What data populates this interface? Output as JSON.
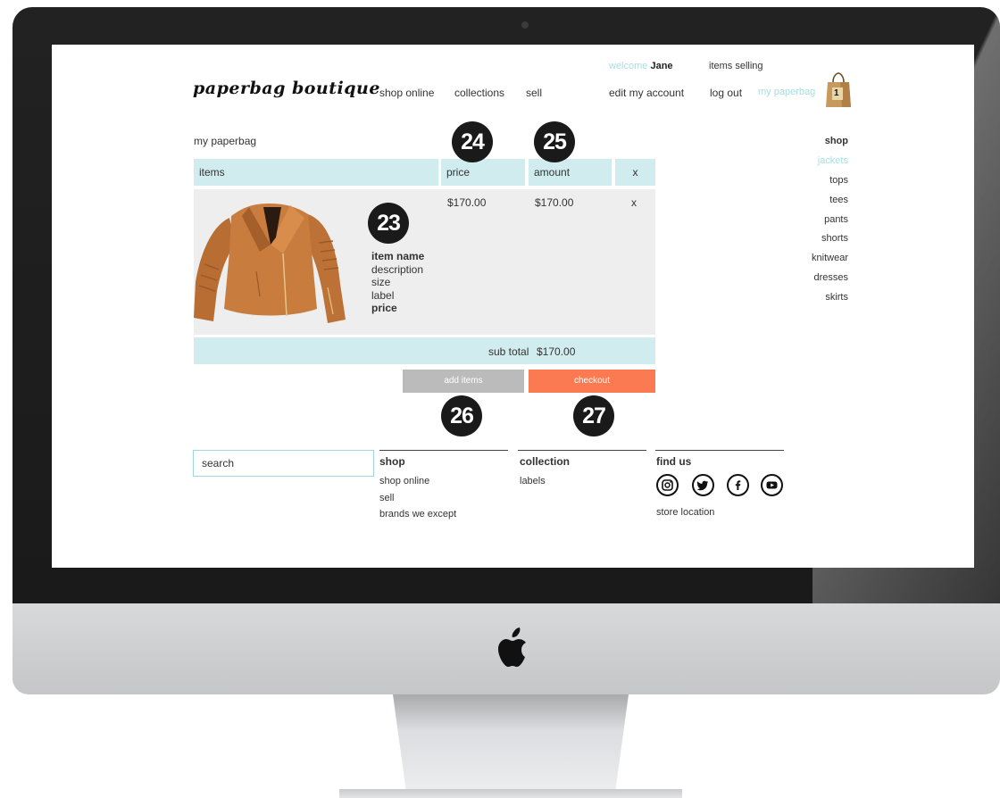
{
  "brand": {
    "logo_text": "paperbag boutique"
  },
  "nav": {
    "shop_online": "shop online",
    "collections": "collections",
    "sell": "sell"
  },
  "account": {
    "welcome_label": "welcome",
    "user_name": "Jane",
    "items_selling": "items selling",
    "edit_account": "edit my account",
    "log_out": "log out",
    "my_paperbag": "my paperbag",
    "bag_count": "1"
  },
  "cart": {
    "title": "my paperbag",
    "headers": {
      "items": "items",
      "price": "price",
      "amount": "amount",
      "remove": "x"
    },
    "item": {
      "name": "item name",
      "description": "description",
      "size": "size",
      "label": "label",
      "price_label": "price",
      "price": "$170.00",
      "amount": "$170.00",
      "remove": "x"
    },
    "subtotal_label": "sub total",
    "subtotal_value": "$170.00",
    "add_items": "add items",
    "checkout": "checkout"
  },
  "annotations": [
    "23",
    "24",
    "25",
    "26",
    "27"
  ],
  "sidebar": {
    "heading": "shop",
    "items": [
      "jackets",
      "tops",
      "tees",
      "pants",
      "shorts",
      "knitwear",
      "dresses",
      "skirts"
    ],
    "active": "jackets"
  },
  "search": {
    "value": "search"
  },
  "footer": {
    "shop": {
      "heading": "shop",
      "links": [
        "shop online",
        "sell",
        "brands we except"
      ]
    },
    "collection": {
      "heading": "collection",
      "links": [
        "labels"
      ]
    },
    "find_us": {
      "heading": "find us",
      "icons": [
        "instagram-icon",
        "twitter-icon",
        "facebook-icon",
        "youtube-icon"
      ],
      "store_location": "store location"
    }
  },
  "colors": {
    "accent": "#a6dde2",
    "table_header": "#d0ecee",
    "checkout": "#fb7a51",
    "add_items": "#bbbbbb",
    "row_bg": "#eeeeee"
  }
}
